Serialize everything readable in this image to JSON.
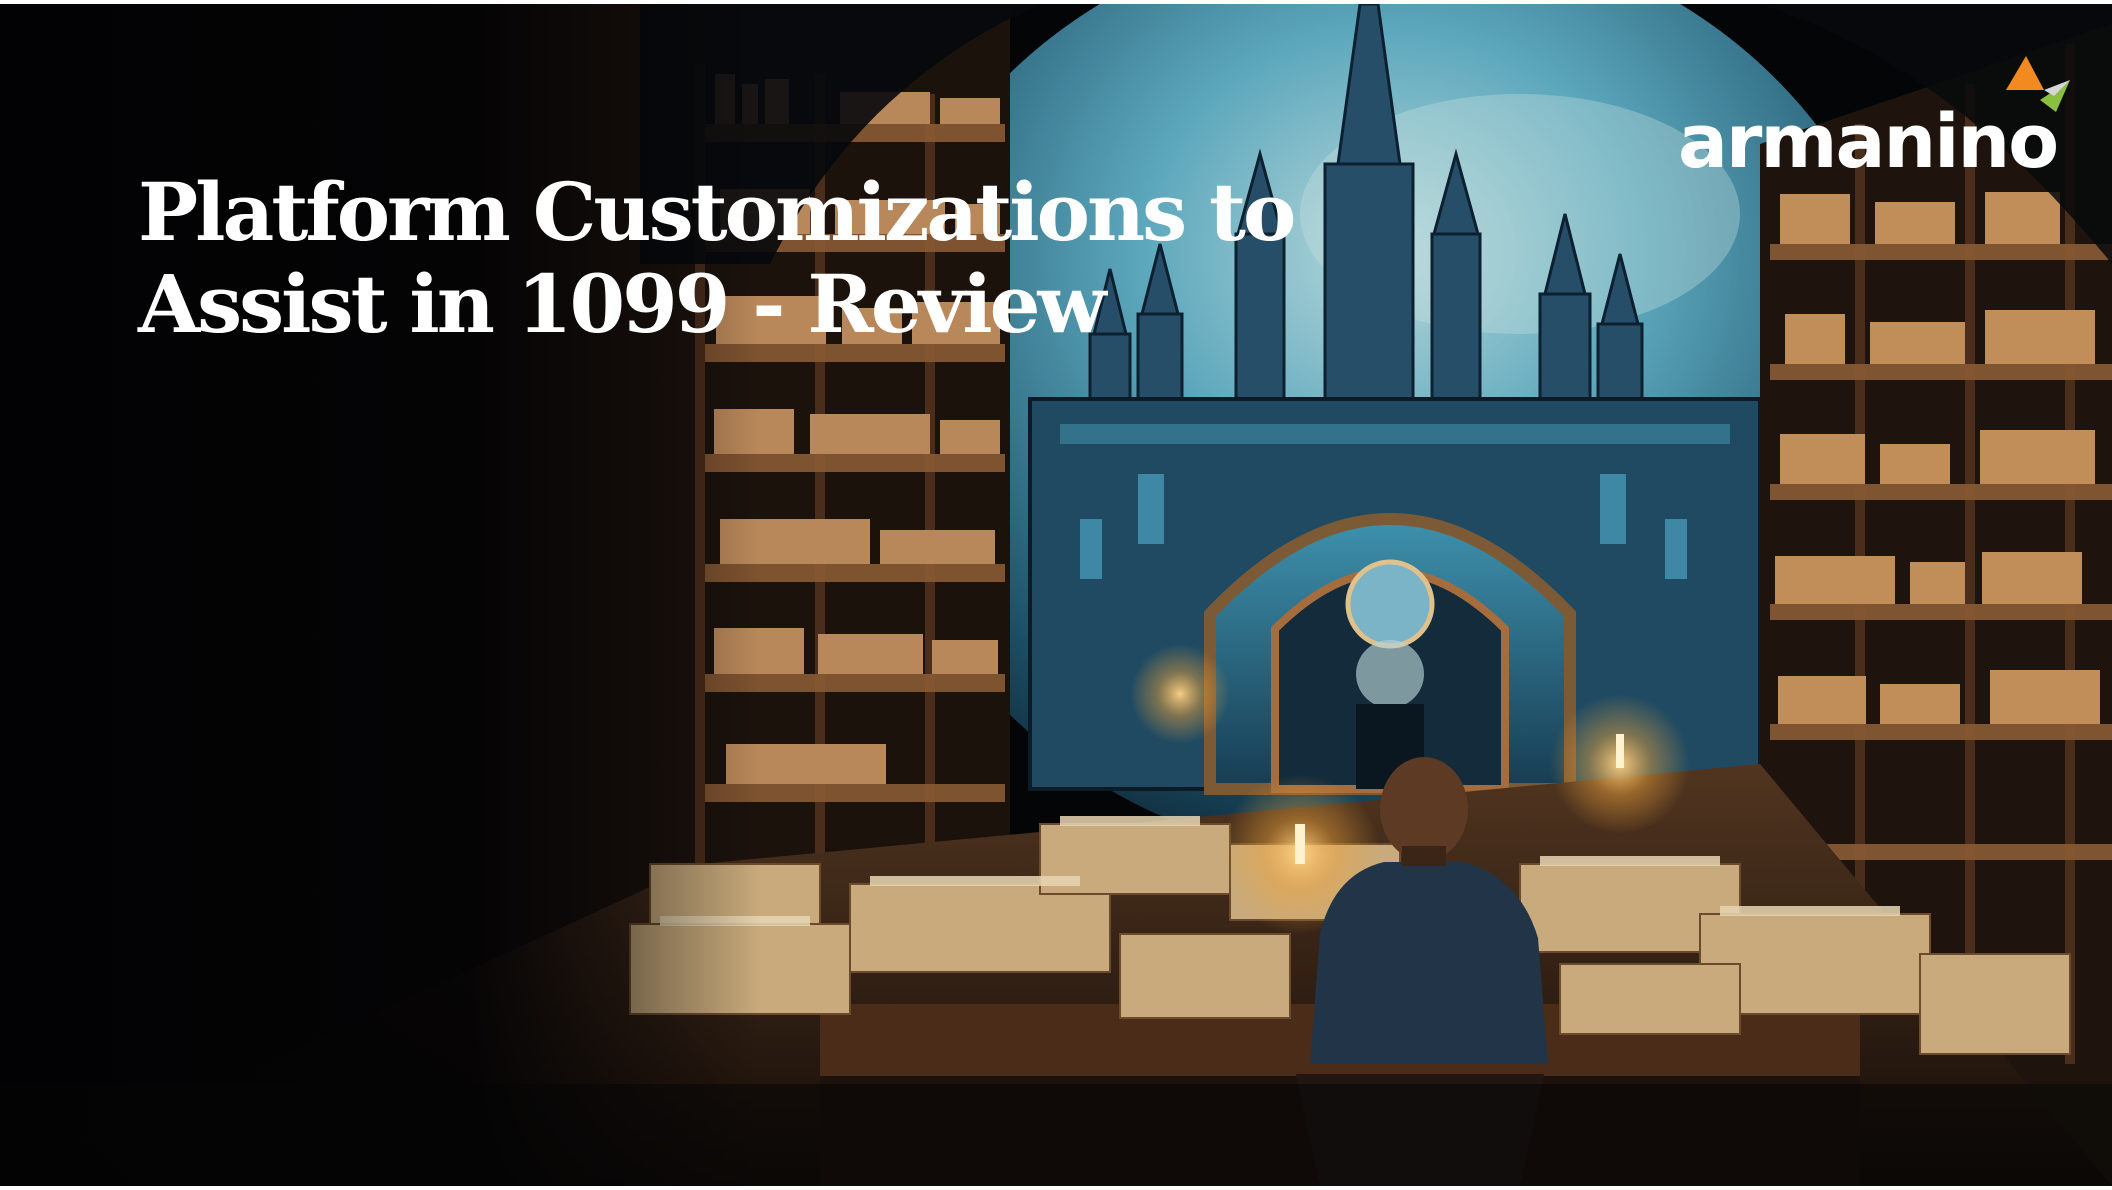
{
  "slide": {
    "title": "Platform Customizations to Assist in 1099 - Review",
    "logo_text": "armanino",
    "logo_icon": "armanino-mark-icon",
    "background_image": "fantasy-library-castle-hero",
    "colors": {
      "title": "#ffffff",
      "logo_text": "#ffffff",
      "logo_orange": "#f28a21",
      "logo_green": "#8bbf3f",
      "logo_gray": "#d6d6d6",
      "sky": "#4fa0b6",
      "background": "#040507"
    }
  }
}
